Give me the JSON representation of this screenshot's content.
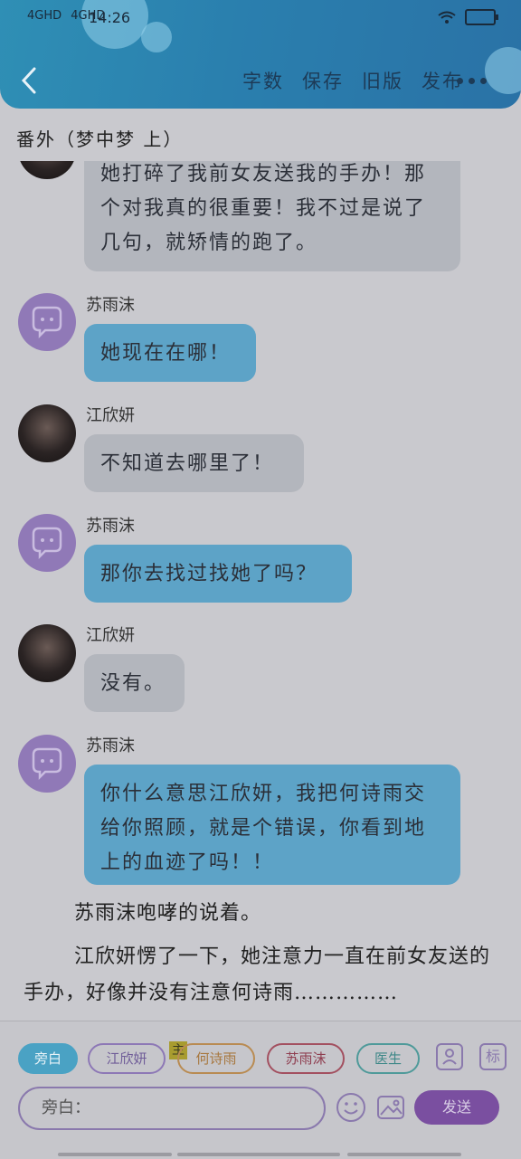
{
  "status_bar": {
    "signal1": "4GHD",
    "signal2": "4GHD",
    "time": "14:26"
  },
  "header": {
    "actions": [
      "字数",
      "保存",
      "旧版",
      "发布"
    ],
    "title": "番外（梦中梦 上）"
  },
  "messages": [
    {
      "speaker": "",
      "side": "gray",
      "text": "她打碎了我前女友送我的手办！那个对我真的很重要！我不过是说了几句，就矫情的跑了。"
    },
    {
      "speaker": "苏雨沫",
      "side": "blue",
      "text": "她现在在哪！"
    },
    {
      "speaker": "江欣妍",
      "side": "gray",
      "text": "不知道去哪里了！"
    },
    {
      "speaker": "苏雨沫",
      "side": "blue",
      "text": "那你去找过找她了吗？"
    },
    {
      "speaker": "江欣妍",
      "side": "gray",
      "text": "没有。"
    },
    {
      "speaker": "苏雨沫",
      "side": "blue",
      "text": "你什么意思江欣妍，我把何诗雨交给你照顾，就是个错误，你看到地上的血迹了吗！！"
    }
  ],
  "narration": [
    "苏雨沫咆哮的说着。",
    "江欣妍愣了一下，她注意力一直在前女友送的手办，好像并没有注意何诗雨……………"
  ],
  "composer": {
    "chips": [
      "旁白",
      "江欣妍",
      "何诗雨",
      "苏雨沫",
      "医生"
    ],
    "main_badge": "主",
    "tag_icon": "标",
    "input_placeholder": "旁白：",
    "send_label": "发送"
  },
  "colors": {
    "header": "#2a7fae",
    "blue_bubble": "#5da3c7",
    "gray_bubble": "#b3b6bd",
    "accent_purple": "#7a4fa0"
  }
}
